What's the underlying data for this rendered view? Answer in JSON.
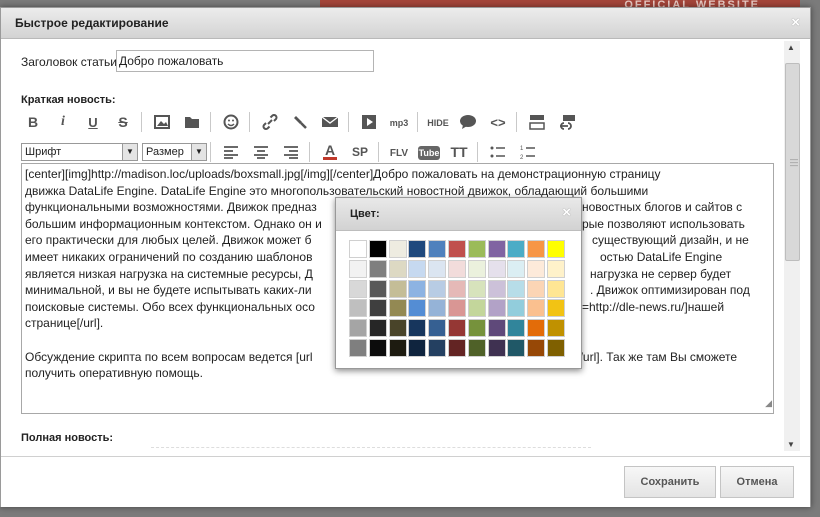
{
  "background": {
    "banner_text": "OFFICIAL WEBSITE"
  },
  "dialog": {
    "title": "Быстрое редактирование",
    "close_label": "×",
    "article_title_label": "Заголовок статьи",
    "article_title_value": "Добро пожаловать",
    "short_news_label": "Краткая новость:",
    "full_news_label": "Полная новость:"
  },
  "toolbar": {
    "row1": [
      {
        "name": "bold-button",
        "icon": "bold-icon",
        "label": "B"
      },
      {
        "name": "italic-button",
        "icon": "italic-icon",
        "label": "i"
      },
      {
        "name": "underline-button",
        "icon": "underline-icon",
        "label": "U"
      },
      {
        "name": "strike-button",
        "icon": "strikethrough-icon",
        "label": "S"
      },
      {
        "name": "image-button",
        "icon": "image-icon",
        "label": ""
      },
      {
        "name": "upload-button",
        "icon": "folder-icon",
        "label": ""
      },
      {
        "name": "smiley-button",
        "icon": "smiley-icon",
        "label": ""
      },
      {
        "name": "link-button",
        "icon": "link-icon",
        "label": ""
      },
      {
        "name": "leech-button",
        "icon": "hammer-icon",
        "label": ""
      },
      {
        "name": "email-button",
        "icon": "envelope-icon",
        "label": ""
      },
      {
        "name": "video-button",
        "icon": "play-icon",
        "label": ""
      },
      {
        "name": "mp3-button",
        "icon": "mp3-icon",
        "label": "mp3"
      },
      {
        "name": "hide-button",
        "icon": "hide-icon",
        "label": "HIDE"
      },
      {
        "name": "quote-button",
        "icon": "speech-bubble-icon",
        "label": ""
      },
      {
        "name": "code-button",
        "icon": "code-icon",
        "label": "<>"
      },
      {
        "name": "pagebreak-button",
        "icon": "page-break-icon",
        "label": ""
      },
      {
        "name": "pagelink-button",
        "icon": "page-link-icon",
        "label": ""
      }
    ],
    "font_select": "Шрифт",
    "size_select": "Размер",
    "row2": [
      {
        "name": "align-left-button",
        "icon": "align-left-icon",
        "label": ""
      },
      {
        "name": "align-center-button",
        "icon": "align-center-icon",
        "label": ""
      },
      {
        "name": "align-right-button",
        "icon": "align-right-icon",
        "label": ""
      },
      {
        "name": "color-button",
        "icon": "text-color-icon",
        "label": "A"
      },
      {
        "name": "spoiler-button",
        "icon": "spoiler-icon",
        "label": "SP"
      },
      {
        "name": "flv-button",
        "icon": "flv-icon",
        "label": "FLV"
      },
      {
        "name": "youtube-button",
        "icon": "youtube-icon",
        "label": "Tube"
      },
      {
        "name": "typograph-button",
        "icon": "typograph-icon",
        "label": "TT"
      },
      {
        "name": "bullet-list-button",
        "icon": "bullet-list-icon",
        "label": ""
      },
      {
        "name": "numbered-list-button",
        "icon": "numbered-list-icon",
        "label": ""
      }
    ]
  },
  "editor": {
    "paragraph1": "[center][img]http://madison.loc/uploads/boxsmall.jpg[/img][/center]Добро пожаловать на демонстрационную страницу движка DataLife Engine. DataLife Engine это многопользовательский новостной движок, обладающий большими функциональными возможностями. Движок предназ                                        новостных блогов и сайтов с большим информационным контекстом. Однако он и                                        ые позволяют использовать его практически для любых целей. Движок может б                                         существующий дизайн, и не имеет никаких ограничений по созданию шаблонов                                           остью DataLife Engine является низкая нагрузка на системные ресурсы, Д                                         нагрузка не сервер будет минимальной, и вы не будете испытывать каких-ли                                         . Движок оптимизирован под поисковые системы. Обо всех функциональных осо                                        =http://dle-news.ru/]нашей странице[/url].",
    "line_texts": [
      "[center][img]http://madison.loc/uploads/boxsmall.jpg[/img][/center]Добро пожаловать на демонстрационную страницу",
      "движка DataLife Engine. DataLife Engine это многопользовательский новостной движок, обладающий большими",
      "функциональными возможностями. Движок предназ",
      "новостных блогов и сайтов с",
      "большим информационным контекстом. Однако он и",
      "рые позволяют использовать",
      "его практически для любых целей. Движок может б",
      "существующий дизайн, и не",
      "имеет никаких ограничений по созданию шаблонов",
      "остью DataLife Engine",
      "является низкая нагрузка на системные ресурсы, Д",
      "нагрузка не сервер будет",
      "минимальной, и вы не будете испытывать каких-ли",
      ". Движок оптимизирован под",
      "поисковые системы. Обо всех функциональных осо",
      "=http://dle-news.ru/]нашей",
      "странице[/url].",
      "Обсуждение скрипта по всем вопросам ведется [url",
      "ь[/url]. Так же там Вы сможете",
      "получить оперативную помощь."
    ]
  },
  "color_palette": {
    "title": "Цвет:",
    "close_label": "×",
    "rows": [
      [
        "#ffffff",
        "#000000",
        "#eeece1",
        "#1f497d",
        "#4f81bd",
        "#c0504d",
        "#9bbb59",
        "#8064a2",
        "#4bacc6",
        "#f79646",
        "#ffff00"
      ],
      [
        "#f2f2f2",
        "#7f7f7f",
        "#ddd9c3",
        "#c6d9f0",
        "#dbe5f1",
        "#f2dcdb",
        "#ebf1dd",
        "#e5e0ec",
        "#dbeef3",
        "#fdeada",
        "#fff2ca"
      ],
      [
        "#d8d8d8",
        "#595959",
        "#c4bd97",
        "#8db3e2",
        "#b8cce4",
        "#e5b9b7",
        "#d7e3bc",
        "#ccc1d9",
        "#b7dde8",
        "#fbd5b5",
        "#ffe694"
      ],
      [
        "#bfbfbf",
        "#3f3f3f",
        "#938953",
        "#548dd4",
        "#95b3d7",
        "#d99694",
        "#c3d69b",
        "#b2a2c7",
        "#92cddc",
        "#fac08f",
        "#f2c314"
      ],
      [
        "#a5a5a5",
        "#262626",
        "#494429",
        "#17365d",
        "#366092",
        "#953734",
        "#76923c",
        "#5f497a",
        "#31859b",
        "#e36c09",
        "#c09100"
      ],
      [
        "#7f7f7f",
        "#0c0c0c",
        "#1d1b10",
        "#0f243e",
        "#244061",
        "#632423",
        "#4f6128",
        "#3f3151",
        "#205867",
        "#974806",
        "#7f6000"
      ]
    ]
  },
  "footer": {
    "save_label": "Сохранить",
    "cancel_label": "Отмена"
  }
}
